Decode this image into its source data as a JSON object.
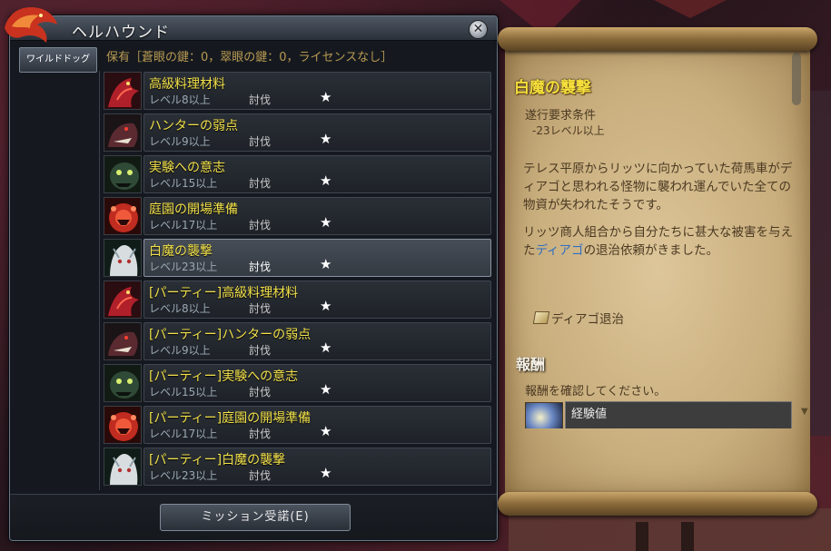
{
  "window": {
    "title": "ヘルハウンド",
    "close": "✕"
  },
  "tabs": [
    {
      "label": "ワイルドドッグ"
    }
  ],
  "holdings": "保有［蒼眼の鍵：0，翠眼の鍵：0，ライセンスなし］",
  "missions": [
    {
      "name": "高級料理材料",
      "level": "レベル8以上",
      "type": "討伐",
      "star": "★",
      "icon": "red-dragon-icon"
    },
    {
      "name": "ハンターの弱点",
      "level": "レベル9以上",
      "type": "討伐",
      "star": "★",
      "icon": "dark-beast-icon"
    },
    {
      "name": "実験への意志",
      "level": "レベル15以上",
      "type": "討伐",
      "star": "★",
      "icon": "green-monster-icon"
    },
    {
      "name": "庭園の開場準備",
      "level": "レベル17以上",
      "type": "討伐",
      "star": "★",
      "icon": "red-plant-monster-icon"
    },
    {
      "name": "白魔の襲撃",
      "level": "レベル23以上",
      "type": "討伐",
      "star": "★",
      "icon": "white-demon-icon",
      "selected": true
    },
    {
      "name": "[パーティー]高級料理材料",
      "level": "レベル8以上",
      "type": "討伐",
      "star": "★",
      "icon": "red-dragon-icon"
    },
    {
      "name": "[パーティー]ハンターの弱点",
      "level": "レベル9以上",
      "type": "討伐",
      "star": "★",
      "icon": "dark-beast-icon"
    },
    {
      "name": "[パーティー]実験への意志",
      "level": "レベル15以上",
      "type": "討伐",
      "star": "★",
      "icon": "green-monster-icon"
    },
    {
      "name": "[パーティー]庭園の開場準備",
      "level": "レベル17以上",
      "type": "討伐",
      "star": "★",
      "icon": "red-plant-monster-icon"
    },
    {
      "name": "[パーティー]白魔の襲撃",
      "level": "レベル23以上",
      "type": "討伐",
      "star": "★",
      "icon": "white-demon-icon"
    }
  ],
  "accept_button": "ミッション受諾(E)",
  "detail": {
    "title": "白魔の襲撃",
    "requirement_heading": "遂行要求条件",
    "requirement_value": "-23レベル以上",
    "paragraph1": "テレス平原からリッツに向かっていた荷馬車がディアゴと思われる怪物に襲われ運んでいた全ての物資が失われたそうです。",
    "paragraph2_before": "リッツ商人組合から自分たちに甚大な被害を与えた",
    "paragraph2_highlight": "ディアゴ",
    "paragraph2_after": "の退治依頼がきました。",
    "objective": "ディアゴ退治",
    "reward_heading": "報酬",
    "reward_sub": "報酬を確認してください。",
    "reward_item": "経験値"
  },
  "colors": {
    "mission_name": "#f2e14a",
    "highlight": "#2f6fbf",
    "quest_title": "#f4df3c"
  }
}
